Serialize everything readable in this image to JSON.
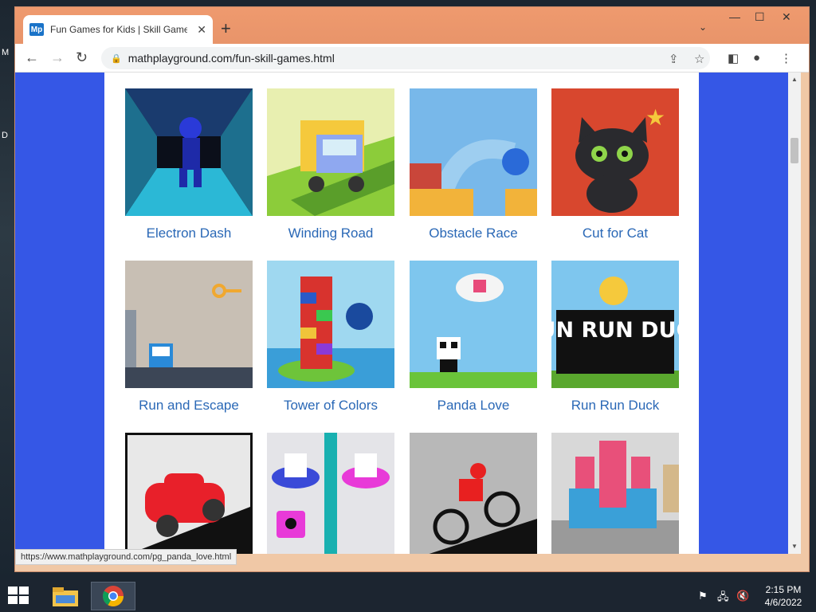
{
  "desktop": {
    "glyph_top": "M",
    "glyph_mid": "D"
  },
  "browser": {
    "tab_title": "Fun Games for Kids | Skill Games",
    "favicon": "Mp",
    "url": "mathplayground.com/fun-skill-games.html",
    "status_url": "https://www.mathplayground.com/pg_panda_love.html"
  },
  "games": [
    {
      "title": "Electron Dash"
    },
    {
      "title": "Winding Road"
    },
    {
      "title": "Obstacle Race"
    },
    {
      "title": "Cut for Cat"
    },
    {
      "title": "Run and Escape"
    },
    {
      "title": "Tower of Colors"
    },
    {
      "title": "Panda Love"
    },
    {
      "title": "Run Run Duck",
      "thumb_text": "RUN RUN DUCK"
    },
    {
      "title": ""
    },
    {
      "title": ""
    },
    {
      "title": ""
    },
    {
      "title": ""
    }
  ],
  "taskbar": {
    "time": "2:15 PM",
    "date": "4/6/2022"
  },
  "colors": {
    "page_bg": "#3557e6",
    "link": "#2a68b6",
    "titlebar": "#ef9a6e"
  }
}
